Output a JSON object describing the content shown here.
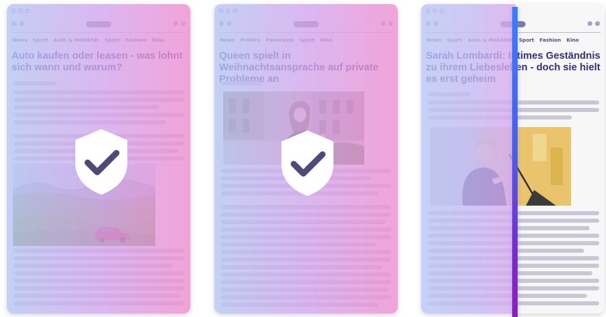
{
  "panels": [
    {
      "nav": [
        "News",
        "Sport",
        "Auto & Mobilität",
        "Sport",
        "Fashion",
        "Kino"
      ],
      "headline": "Auto kaufen oder leasen - was lohnt sich wann und warum?",
      "image": "red car on a hillside meadow",
      "badge": "shield-check-icon",
      "state": "protected"
    },
    {
      "nav": [
        "News",
        "Politics",
        "Panorama",
        "Sport",
        "Kino"
      ],
      "headline": "Queen spielt in Weihnachtsansprache auf private Probleme an",
      "image": "woman posing in a city square",
      "badge": "shield-check-icon",
      "state": "protected"
    },
    {
      "nav": [
        "News",
        "Sport",
        "Auto & Mobilität",
        "Sport",
        "Fashion",
        "Kino"
      ],
      "headline": "Sarah Lombardi: Intimes Geständnis zu ihrem Liebesleben - doch sie hielt es erst geheim",
      "image": "woman speaking at a microphone",
      "badge": "scan-line",
      "state": "scanning"
    }
  ],
  "colors": {
    "gradient_start": "#b7c6f3",
    "gradient_end": "#f08fd0",
    "headline": "#323278",
    "scan_line_top": "#3f7cf7",
    "scan_line_bottom": "#8c1fb6",
    "shield": "#ffffff",
    "check": "#4d4a7a"
  }
}
